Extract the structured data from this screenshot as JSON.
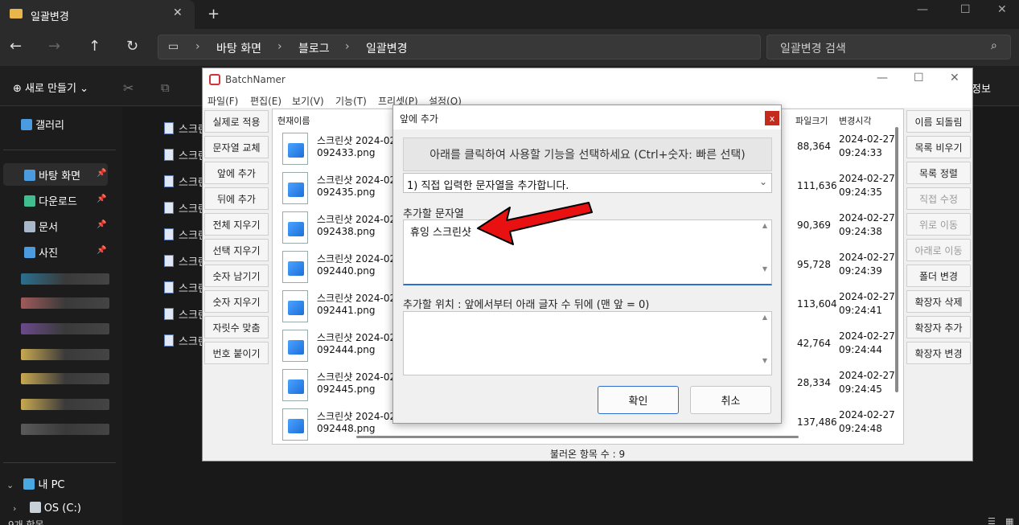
{
  "explorer": {
    "tab_title": "일괄변경",
    "tab_close": "✕",
    "new_tab": "+",
    "breadcrumb": [
      "바탕 화면",
      "블로그",
      "일괄변경"
    ],
    "search_placeholder": "일괄변경 검색",
    "new_button": "새로 만들기",
    "details_label": "정보",
    "sidebar": [
      {
        "label": "갤러리",
        "icon": "gallery-icon",
        "color": "#4a9be0"
      },
      {
        "label": "바탕 화면",
        "icon": "desktop-icon",
        "color": "#4a9be0"
      },
      {
        "label": "다운로드",
        "icon": "download-icon",
        "color": "#3fbf8f"
      },
      {
        "label": "문서",
        "icon": "document-icon",
        "color": "#a8b8c8"
      },
      {
        "label": "사진",
        "icon": "picture-icon",
        "color": "#4a9be0"
      },
      {
        "label": "내 PC",
        "icon": "pc-icon",
        "color": "#4aa8e0"
      },
      {
        "label": "OS (C:)",
        "icon": "drive-icon",
        "color": "#c8d0d8"
      }
    ],
    "content_items": [
      "스크린",
      "스크린",
      "스크린",
      "스크린",
      "스크린",
      "스크린",
      "스크린",
      "스크린",
      "스크린"
    ],
    "status_text": "9개 항목"
  },
  "batchnamer": {
    "title": "BatchNamer",
    "menu": [
      "파일(F)",
      "편집(E)",
      "보기(V)",
      "기능(T)",
      "프리셋(P)",
      "설정(O)"
    ],
    "left_buttons": [
      "실제로 적용",
      "문자열 교체",
      "앞에 추가",
      "뒤에 추가",
      "전체 지우기",
      "선택 지우기",
      "숫자 남기기",
      "숫자 지우기",
      "자릿수 맞춤",
      "번호 붙이기"
    ],
    "right_buttons": [
      {
        "label": "이름 되돌림",
        "enabled": true
      },
      {
        "label": "목록 비우기",
        "enabled": true
      },
      {
        "label": "목록 정렬",
        "enabled": true
      },
      {
        "label": "직접 수정",
        "enabled": false
      },
      {
        "label": "위로 이동",
        "enabled": false
      },
      {
        "label": "아래로 이동",
        "enabled": false
      },
      {
        "label": "폴더 변경",
        "enabled": true
      },
      {
        "label": "확장자 삭제",
        "enabled": true
      },
      {
        "label": "확장자 추가",
        "enabled": true
      },
      {
        "label": "확장자 변경",
        "enabled": true
      }
    ],
    "columns": {
      "current_name": "현재이름",
      "size": "파일크기",
      "modified": "변경시각"
    },
    "files": [
      {
        "name1": "스크린샷 2024-02-",
        "name2": "092433.png",
        "size": "88,364",
        "date": "2024-02-27",
        "time": "09:24:33"
      },
      {
        "name1": "스크린샷 2024-02-",
        "name2": "092435.png",
        "size": "111,636",
        "date": "2024-02-27",
        "time": "09:24:35"
      },
      {
        "name1": "스크린샷 2024-02-",
        "name2": "092438.png",
        "size": "90,369",
        "date": "2024-02-27",
        "time": "09:24:38"
      },
      {
        "name1": "스크린샷 2024-02-",
        "name2": "092440.png",
        "size": "95,728",
        "date": "2024-02-27",
        "time": "09:24:39"
      },
      {
        "name1": "스크린샷 2024-02-",
        "name2": "092441.png",
        "size": "113,604",
        "date": "2024-02-27",
        "time": "09:24:41"
      },
      {
        "name1": "스크린샷 2024-02-",
        "name2": "092444.png",
        "size": "42,764",
        "date": "2024-02-27",
        "time": "09:24:44"
      },
      {
        "name1": "스크린샷 2024-02-",
        "name2": "092445.png",
        "size": "28,334",
        "date": "2024-02-27",
        "time": "09:24:45"
      },
      {
        "name1": "스크린샷 2024-02-",
        "name2": "092448.png",
        "size": "137,486",
        "date": "2024-02-27",
        "time": "09:24:48"
      }
    ],
    "status": "불러온 항목 수 : 9"
  },
  "dialog": {
    "title": "앞에 추가",
    "close": "x",
    "hint": "아래를 클릭하여 사용할 기능을 선택하세요 (Ctrl+숫자: 빠른 선택)",
    "mode_selected": "1) 직접 입력한 문자열을 추가합니다.",
    "string_label": "추가할 문자열",
    "string_value": "휴잉 스크린샷",
    "position_label": "추가할 위치 : 앞에서부터 아래 글자 수 뒤에 (맨 앞 = 0)",
    "position_value": "",
    "ok_label": "확인",
    "cancel_label": "취소",
    "accent_color": "#2f6dd1",
    "arrow_color": "#e81010"
  }
}
